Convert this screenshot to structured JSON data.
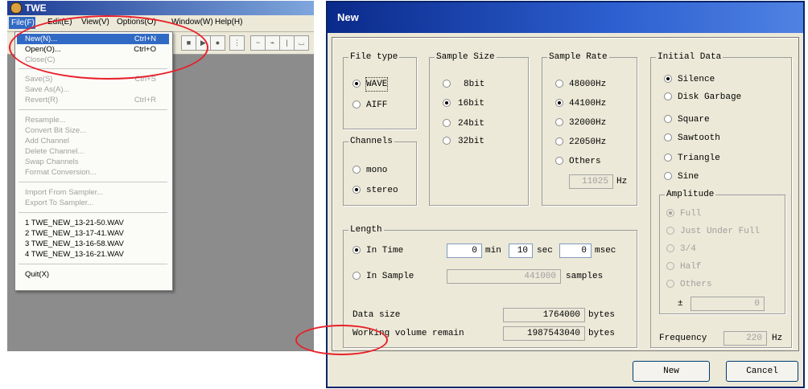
{
  "left_app": {
    "title": "TWE",
    "menu": [
      "File(F)",
      "Edit(E)",
      "View(V)",
      "Options(O)",
      "Window(W)",
      "Help(H)"
    ],
    "file_menu": {
      "items": [
        {
          "label": "New(N)...",
          "shortcut": "Ctrl+N"
        },
        {
          "label": "Open(O)...",
          "shortcut": "Ctrl+O"
        },
        {
          "label": "Close(C)",
          "shortcut": ""
        },
        {
          "label": "Save(S)",
          "shortcut": "Ctrl+S"
        },
        {
          "label": "Save As(A)...",
          "shortcut": ""
        },
        {
          "label": "Revert(R)",
          "shortcut": "Ctrl+R"
        },
        {
          "label": "Resample...",
          "shortcut": ""
        },
        {
          "label": "Convert Bit Size...",
          "shortcut": ""
        },
        {
          "label": "Add Channel",
          "shortcut": ""
        },
        {
          "label": "Delete Channel...",
          "shortcut": ""
        },
        {
          "label": "Swap Channels",
          "shortcut": ""
        },
        {
          "label": "Format Conversion...",
          "shortcut": ""
        },
        {
          "label": "Import From Sampler...",
          "shortcut": ""
        },
        {
          "label": "Export To Sampler...",
          "shortcut": ""
        },
        {
          "label": "1 TWE_NEW_13-21-50.WAV",
          "shortcut": ""
        },
        {
          "label": "2 TWE_NEW_13-17-41.WAV",
          "shortcut": ""
        },
        {
          "label": "3 TWE_NEW_13-16-58.WAV",
          "shortcut": ""
        },
        {
          "label": "4 TWE_NEW_13-16-21.WAV",
          "shortcut": ""
        },
        {
          "label": "Quit(X)",
          "shortcut": ""
        }
      ]
    }
  },
  "dialog": {
    "title": "New",
    "file_type": {
      "legend": "File type",
      "options": [
        "WAVE",
        "AIFF"
      ],
      "selected": "WAVE"
    },
    "sample_size": {
      "legend": "Sample Size",
      "options": [
        "8bit",
        "16bit",
        "24bit",
        "32bit"
      ],
      "selected": "16bit"
    },
    "sample_rate": {
      "legend": "Sample Rate",
      "options": [
        "48000Hz",
        "44100Hz",
        "32000Hz",
        "22050Hz",
        "Others"
      ],
      "selected": "44100Hz",
      "others_value": "11025",
      "others_unit": "Hz"
    },
    "channels": {
      "legend": "Channels",
      "options": [
        "mono",
        "stereo"
      ],
      "selected": "stereo"
    },
    "initial_data": {
      "legend": "Initial Data",
      "options": [
        "Silence",
        "Disk Garbage",
        "Square",
        "Sawtooth",
        "Triangle",
        "Sine"
      ],
      "selected": "Silence"
    },
    "amplitude": {
      "legend": "Amplitude",
      "options": [
        "Full",
        "Just Under Full",
        "3/4",
        "Half",
        "Others"
      ],
      "selected": "Full",
      "pm": "±",
      "value": "0"
    },
    "frequency": {
      "label": "Frequency",
      "value": "220",
      "unit": "Hz"
    },
    "length": {
      "legend": "Length",
      "in_time_label": "In Time",
      "min_value": "0",
      "min_label": "min",
      "sec_value": "10",
      "sec_label": "sec",
      "msec_value": "0",
      "msec_label": "msec",
      "in_sample_label": "In Sample",
      "samples_value": "441000",
      "samples_label": "samples",
      "selected": "In Time"
    },
    "data_size": {
      "label": "Data size",
      "value": "1764000",
      "unit": "bytes"
    },
    "working_volume": {
      "label": "Working volume remain",
      "value": "1987543040",
      "unit": "bytes"
    },
    "buttons": {
      "new": "New",
      "cancel": "Cancel"
    }
  }
}
